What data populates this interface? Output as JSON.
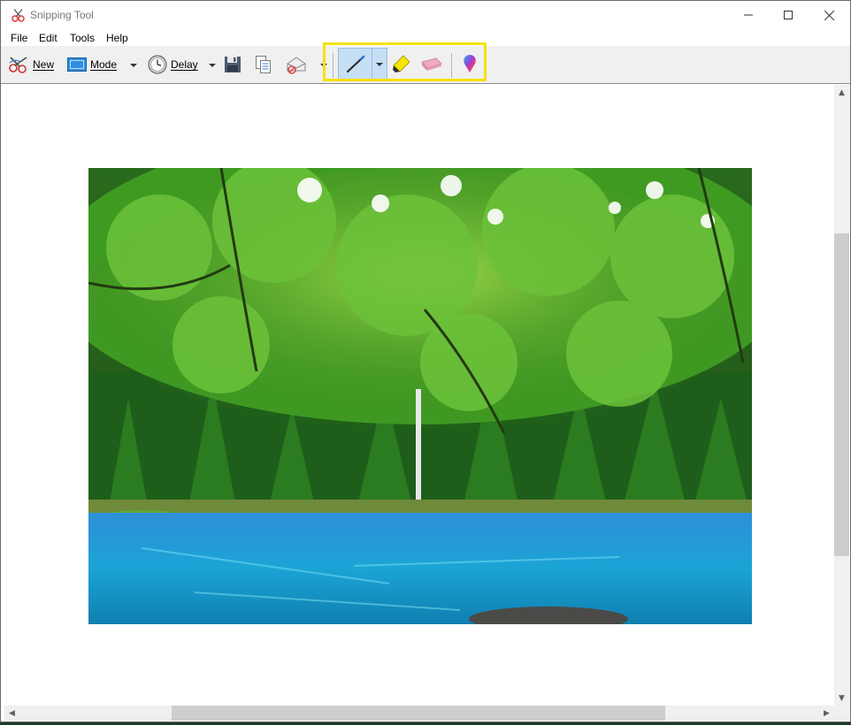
{
  "window": {
    "title": "Snipping Tool"
  },
  "menu": {
    "file": "File",
    "edit": "Edit",
    "tools": "Tools",
    "help": "Help"
  },
  "toolbar": {
    "new_label": "New",
    "mode_label": "Mode",
    "delay_label": "Delay"
  },
  "icons": {
    "new": "scissors-icon",
    "mode": "rectangle-snip-icon",
    "delay": "clock-icon",
    "save": "floppy-disk-icon",
    "copy": "copy-icon",
    "send": "envelope-icon",
    "pen": "pen-icon",
    "highlighter": "highlighter-icon",
    "eraser": "eraser-icon",
    "paint3d": "paint-3d-icon"
  },
  "colors": {
    "highlight_box": "#f5e10f",
    "pen_active": "#c7dff5",
    "toolbar_bg": "#f0f0f0"
  },
  "canvas": {
    "image_description_icon": "landscape-photo"
  }
}
